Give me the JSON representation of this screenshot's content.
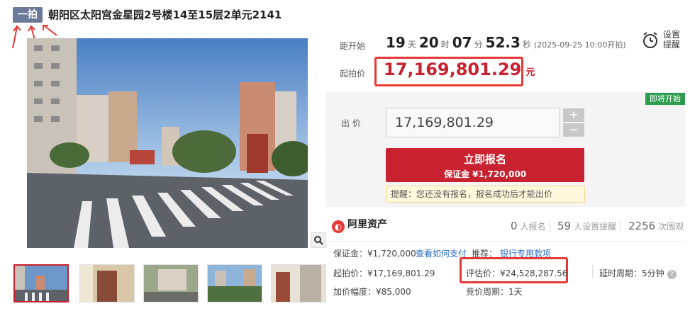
{
  "header": {
    "round_badge": "一拍",
    "title": "朝阳区太阳宫金星园2号楼14至15层2单元2141"
  },
  "countdown": {
    "label": "距开始",
    "days": "19",
    "days_unit": "天",
    "hours": "20",
    "hours_unit": "时",
    "minutes": "07",
    "minutes_unit": "分",
    "seconds": "52.3",
    "seconds_unit": "秒",
    "start_note": "(2025-09-25 10:00开拍)"
  },
  "reminder": {
    "label_line1": "设置",
    "label_line2": "提醒"
  },
  "starting_price": {
    "label": "起拍价",
    "value": "17,169,801.29",
    "unit": "元"
  },
  "status_tag": "即将开始",
  "bid": {
    "label": "出 价",
    "input_value": "17,169,801.29",
    "plus": "+",
    "minus": "−"
  },
  "signup": {
    "label": "立即报名",
    "deposit": "保证金 ¥1,720,000"
  },
  "tip": "提醒：您还没有报名，报名成功后才能出价",
  "platform": {
    "name": "阿里资产",
    "icon": "ali-asset-logo"
  },
  "stats": [
    {
      "value": "0",
      "label": "人报名"
    },
    {
      "value": "59",
      "label": "人设置提醒"
    },
    {
      "value": "2256",
      "label": "次围观"
    }
  ],
  "details": {
    "deposit_label": "保证金：¥1,720,000",
    "deposit_link": "查看如何支付",
    "recommend_label": "推荐：",
    "recommend_link": "银行专用款项",
    "start_price": "起拍价：¥17,169,801.29",
    "eval_price": "评估价：¥24,528,287.56",
    "delay_period": "延时周期：5分钟",
    "increment": "加价幅度：¥85,000",
    "bid_period": "竞价周期：1天"
  },
  "colors": {
    "accent": "#c8212f",
    "highlight_border": "#e53935",
    "status_green": "#2e9c4e",
    "badge_gray": "#6b7a99",
    "link_blue": "#2a6cc4"
  }
}
